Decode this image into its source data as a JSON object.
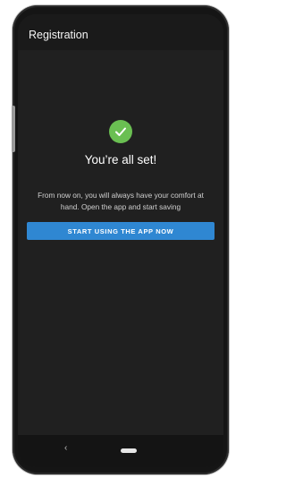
{
  "header": {
    "title": "Registration"
  },
  "success": {
    "icon": "check-circle-icon",
    "headline": "You’re all set!",
    "description": "From now on, you will always have your comfort at hand. Open the app and start saving"
  },
  "cta": {
    "label": "START USING THE APP NOW"
  },
  "navbar": {
    "back_icon": "‹"
  },
  "colors": {
    "accent": "#2f87d2",
    "success": "#6abf52",
    "background": "#202020"
  }
}
